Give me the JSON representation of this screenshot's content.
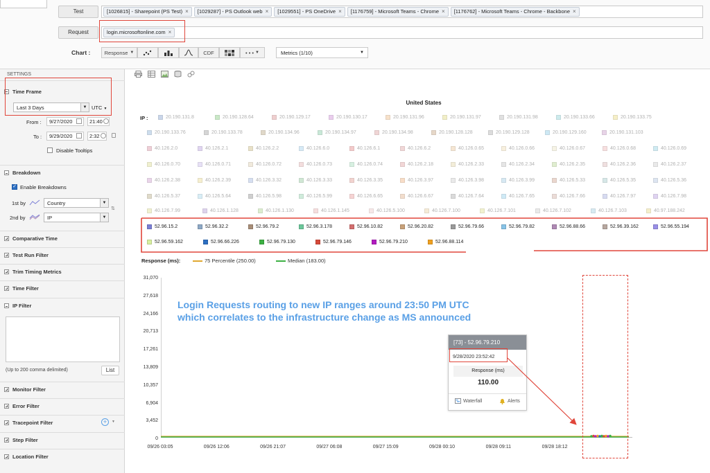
{
  "filters": {
    "test_label": "Test",
    "tests": [
      {
        "label": "[1026815] - Sharepoint (PS Test)"
      },
      {
        "label": "[1029287] - PS Outlook web"
      },
      {
        "label": "[1029551] - PS OneDrive"
      },
      {
        "label": "[1176759] - Microsoft Teams - Chrome"
      },
      {
        "label": "[1176762] - Microsoft Teams - Chrome - Backbone"
      }
    ],
    "remove_glyph": "×",
    "request_label": "Request",
    "request_chip": "login.microsoftonline.com"
  },
  "chart_toolbar": {
    "label": "Chart :",
    "response_label": "Response",
    "cdf_label": "CDF",
    "more_label": "• • •",
    "metrics_label": "Metrics (1/10)"
  },
  "settings": {
    "header": "SETTINGS",
    "time_frame": {
      "title": "Time Frame",
      "range_value": "Last 3 Days",
      "timezone": "UTC",
      "from_label": "From :",
      "from_date": "9/27/2020",
      "from_time": "21:40",
      "to_label": "To :",
      "to_date": "9/29/2020",
      "to_time": "2:32",
      "disable_tooltips": "Disable Tooltips"
    },
    "breakdown": {
      "title": "Breakdown",
      "enable": "Enable Breakdowns",
      "first_label": "1st by",
      "first_value": "Country",
      "second_label": "2nd by",
      "second_value": "IP"
    },
    "sections": [
      "Comparative Time",
      "Test Run Filter",
      "Trim Timing Metrics",
      "Time Filter"
    ],
    "ip_filter": {
      "title": "IP Filter",
      "hint": "(Up to 200 comma delimited)",
      "list_button": "List"
    },
    "lower_sections": [
      "Monitor Filter",
      "Error Filter",
      "Tracepoint Filter",
      "Step Filter",
      "Location Filter"
    ]
  },
  "chart": {
    "country": "United States",
    "ip_label": "IP :",
    "annotation_line1": "Login Requests routing to new IP ranges around 23:50 PM UTC",
    "annotation_line2": "which correlates to the infrastructure change as MS announced",
    "response_label": "Response (ms):",
    "p75_label": "75 Percentile (250.00)",
    "median_label": "Median (183.00)",
    "colors": {
      "p75": "#e0a830",
      "median": "#3cb043",
      "accent": "#e0453a",
      "annotation": "#5aa0e6"
    }
  },
  "tooltip": {
    "header": "[73] - 52.96.79.210",
    "timestamp": "9/28/2020 23:52:42",
    "metric_label": "Response (ms)",
    "metric_value": "110.00",
    "waterfall": "Waterfall",
    "alerts": "Alerts"
  },
  "legend_faded": [
    {
      "ip": "20.190.131.8",
      "color": "#9fb6d9"
    },
    {
      "ip": "20.190.128.64",
      "color": "#9fd69a"
    },
    {
      "ip": "20.190.129.17",
      "color": "#e3a9a9"
    },
    {
      "ip": "20.190.130.17",
      "color": "#d9a6e0"
    },
    {
      "ip": "20.190.131.96",
      "color": "#f1c9a0"
    },
    {
      "ip": "20.190.131.97",
      "color": "#e8e39a"
    },
    {
      "ip": "20.190.131.98",
      "color": "#c7c7c7"
    },
    {
      "ip": "20.190.133.66",
      "color": "#a6dce0"
    },
    {
      "ip": "20.190.133.75",
      "color": "#efe29a"
    },
    {
      "ip": "20.190.133.76",
      "color": "#a6c3df"
    },
    {
      "ip": "20.190.133.78",
      "color": "#b3b3b3"
    },
    {
      "ip": "20.190.134.96",
      "color": "#c8b99d"
    },
    {
      "ip": "20.190.134.97",
      "color": "#9ed6b8"
    },
    {
      "ip": "20.190.134.98",
      "color": "#e4b3b3"
    },
    {
      "ip": "20.190.128.128",
      "color": "#d3b89c"
    },
    {
      "ip": "20.190.129.128",
      "color": "#c1c1c1"
    },
    {
      "ip": "20.190.129.160",
      "color": "#a6d6ec"
    },
    {
      "ip": "20.190.131.103",
      "color": "#d5b0d5"
    },
    {
      "ip": "40.126.2.0",
      "color": "#e2a8b8"
    },
    {
      "ip": "40.126.2.1",
      "color": "#c7b4e6"
    },
    {
      "ip": "40.126.2.2",
      "color": "#d8ca9c"
    },
    {
      "ip": "40.126.6.0",
      "color": "#b5d9ef"
    },
    {
      "ip": "40.126.6.1",
      "color": "#ea9f9f"
    },
    {
      "ip": "40.126.6.2",
      "color": "#e7b7b7"
    },
    {
      "ip": "40.126.0.65",
      "color": "#f0d3b0"
    },
    {
      "ip": "40.126.0.66",
      "color": "#f4e4c4"
    },
    {
      "ip": "40.126.0.67",
      "color": "#f0ead0"
    },
    {
      "ip": "40.126.0.68",
      "color": "#f1c6c6"
    },
    {
      "ip": "40.126.0.69",
      "color": "#a8dbe8"
    },
    {
      "ip": "40.126.0.70",
      "color": "#e4e4a8"
    },
    {
      "ip": "40.126.0.71",
      "color": "#d4c8f0"
    },
    {
      "ip": "40.126.0.72",
      "color": "#e6d9c0"
    },
    {
      "ip": "40.126.0.73",
      "color": "#eac3c3"
    },
    {
      "ip": "40.126.0.74",
      "color": "#b7e4c9"
    },
    {
      "ip": "40.126.2.18",
      "color": "#e8b5b5"
    },
    {
      "ip": "40.126.2.33",
      "color": "#eadfb9"
    },
    {
      "ip": "40.126.2.34",
      "color": "#d0d0d0"
    },
    {
      "ip": "40.126.2.35",
      "color": "#c6e0a9"
    },
    {
      "ip": "40.126.2.36",
      "color": "#e3c6c6"
    },
    {
      "ip": "40.126.2.37",
      "color": "#d8d8d8"
    },
    {
      "ip": "40.126.2.38",
      "color": "#dab4da"
    },
    {
      "ip": "40.126.2.39",
      "color": "#f0e3a8"
    },
    {
      "ip": "40.126.3.32",
      "color": "#b6c6e6"
    },
    {
      "ip": "40.126.3.33",
      "color": "#aad5b1"
    },
    {
      "ip": "40.126.3.35",
      "color": "#e8b0a8"
    },
    {
      "ip": "40.126.3.97",
      "color": "#f3c29a"
    },
    {
      "ip": "40.126.3.98",
      "color": "#d9d9d9"
    },
    {
      "ip": "40.126.3.99",
      "color": "#b7d8ea"
    },
    {
      "ip": "40.126.5.33",
      "color": "#d9b6a6"
    },
    {
      "ip": "40.126.5.35",
      "color": "#b5d5d5"
    },
    {
      "ip": "40.126.5.36",
      "color": "#c2d0e6"
    },
    {
      "ip": "40.126.5.37",
      "color": "#c8bfa0"
    },
    {
      "ip": "40.126.5.64",
      "color": "#b9e0ef"
    },
    {
      "ip": "40.126.5.98",
      "color": "#a9a9a9"
    },
    {
      "ip": "40.126.5.99",
      "color": "#a8dcbf"
    },
    {
      "ip": "40.126.6.65",
      "color": "#efb0b0"
    },
    {
      "ip": "40.126.6.67",
      "color": "#e8c2a4"
    },
    {
      "ip": "40.126.7.64",
      "color": "#bdbdbd"
    },
    {
      "ip": "40.126.7.65",
      "color": "#a8d9ef"
    },
    {
      "ip": "40.126.7.66",
      "color": "#dcc0b8"
    },
    {
      "ip": "40.126.7.97",
      "color": "#b8bfe6"
    },
    {
      "ip": "40.126.7.98",
      "color": "#c6b0e6"
    },
    {
      "ip": "40.126.7.99",
      "color": "#e6e6a8"
    },
    {
      "ip": "40.126.1.128",
      "color": "#c4b0e0"
    },
    {
      "ip": "40.126.1.130",
      "color": "#c0e0a8"
    },
    {
      "ip": "40.126.1.145",
      "color": "#efc4c4"
    },
    {
      "ip": "40.126.5.100",
      "color": "#f2d7d7"
    },
    {
      "ip": "40.126.7.100",
      "color": "#f0ddb8"
    },
    {
      "ip": "40.126.7.101",
      "color": "#e8e8a8"
    },
    {
      "ip": "40.126.7.102",
      "color": "#dadada"
    },
    {
      "ip": "40.126.7.103",
      "color": "#b8dbe9"
    },
    {
      "ip": "40.97.188.242",
      "color": "#eee2a0"
    }
  ],
  "legend_highlight": [
    {
      "ip": "52.96.15.2",
      "color": "#7b7fd6"
    },
    {
      "ip": "52.96.32.2",
      "color": "#8ea9c6"
    },
    {
      "ip": "52.96.79.2",
      "color": "#a88e78"
    },
    {
      "ip": "52.96.3.178",
      "color": "#6cc79a"
    },
    {
      "ip": "52.96.10.82",
      "color": "#d46f6f"
    },
    {
      "ip": "52.96.20.82",
      "color": "#c9a27a"
    },
    {
      "ip": "52.96.79.66",
      "color": "#9a9a9a"
    },
    {
      "ip": "52.96.79.82",
      "color": "#88c4e8"
    },
    {
      "ip": "52.96.88.66",
      "color": "#b08ab5"
    },
    {
      "ip": "52.96.39.162",
      "color": "#b8a8a0"
    },
    {
      "ip": "52.96.55.194",
      "color": "#9a90e8"
    },
    {
      "ip": "52.96.59.162",
      "color": "#d9f0a0"
    },
    {
      "ip": "52.96.66.226",
      "color": "#2d6fc2"
    },
    {
      "ip": "52.96.79.130",
      "color": "#3cb043"
    },
    {
      "ip": "52.96.79.146",
      "color": "#d64a3a"
    },
    {
      "ip": "52.96.79.210",
      "color": "#b21cc0"
    },
    {
      "ip": "52.96.88.114",
      "color": "#f0a020"
    }
  ],
  "chart_data": {
    "type": "scatter",
    "title": "United States",
    "ylabel": "Response (ms):",
    "ylim": [
      0,
      31070
    ],
    "yticks": [
      "31,070",
      "27,618",
      "24,166",
      "20,713",
      "17,261",
      "13,809",
      "10,357",
      "6,904",
      "3,452",
      "0"
    ],
    "xticks": [
      "09/26 03:05",
      "09/26 12:06",
      "09/26 21:07",
      "09/27 06:08",
      "09/27 15:09",
      "09/28 00:10",
      "09/28 09:11",
      "09/28 18:12"
    ],
    "series": [
      {
        "name": "75 Percentile (250.00)",
        "type": "line",
        "value": 250
      },
      {
        "name": "Median (183.00)",
        "type": "line",
        "value": 183
      }
    ],
    "highlighted_point": {
      "label": "[73] - 52.96.79.210",
      "time": "9/28/2020 23:52:42",
      "value": 110
    }
  }
}
